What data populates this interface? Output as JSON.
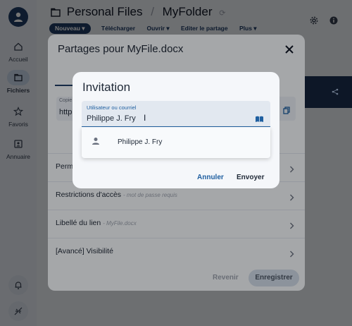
{
  "rail": {
    "items": [
      {
        "label": "Accueil"
      },
      {
        "label": "Fichiers"
      },
      {
        "label": "Favoris"
      },
      {
        "label": "Annuaire"
      }
    ]
  },
  "header": {
    "crumb_root": "Personal Files",
    "crumb_sep": "/",
    "crumb_current": "MyFolder",
    "toolbar": {
      "nouveau": "Nouveau ▾",
      "telecharger": "Télécharger",
      "ouvrir": "Ouvrir ▾",
      "editer": "Editer le partage",
      "plus": "Plus ▾"
    }
  },
  "share_dialog": {
    "title": "Partages pour MyFile.docx",
    "copy_label": "Copie",
    "copy_value": "http",
    "rows": {
      "perm": "Perm",
      "restrictions": "Restrictions d'accès",
      "restrictions_hint": "- mot de passe requis",
      "libelle": "Libellé du lien",
      "libelle_hint": "- MyFile.docx",
      "visibilite": "[Avancé] Visibilité"
    },
    "revenir": "Revenir",
    "enregistrer": "Enregistrer"
  },
  "invite_dialog": {
    "title": "Invitation",
    "field_label": "Utilisateur ou courriel",
    "field_value": "Philippe J. Fry",
    "suggestion": "Philippe J. Fry",
    "annuler": "Annuler",
    "envoyer": "Envoyer"
  },
  "colors": {
    "primary": "#1f3d66",
    "accent": "#1f5fa0"
  }
}
